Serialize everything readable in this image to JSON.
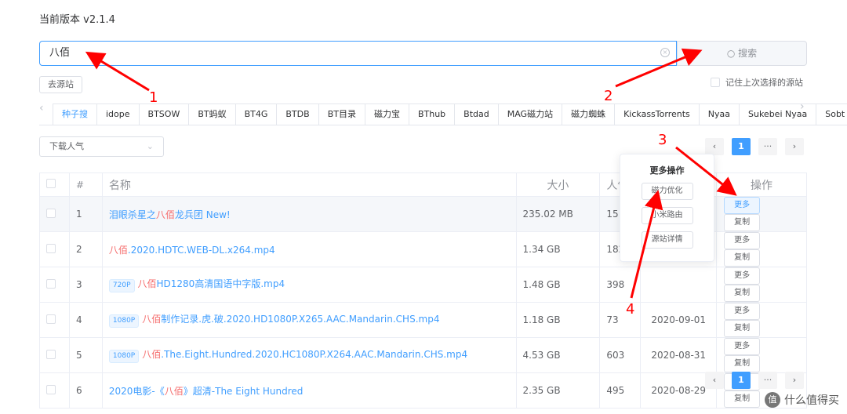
{
  "version": "当前版本 v2.1.4",
  "search": {
    "value": "八佰",
    "button": "搜索"
  },
  "go_source": "去源站",
  "remember": "记住上次选择的源站",
  "tabs": [
    "种子搜",
    "idope",
    "BTSOW",
    "BT蚂蚁",
    "BT4G",
    "BTDB",
    "BT目录",
    "磁力宝",
    "BThub",
    "Btdad",
    "MAG磁力站",
    "磁力蜘蛛",
    "KickassTorrents",
    "Nyaa",
    "Sukebei Nyaa",
    "Sobt"
  ],
  "sort": "下载人气",
  "pager": {
    "current": "1",
    "more": "···"
  },
  "table": {
    "headers": {
      "num": "#",
      "name": "名称",
      "size": "大小",
      "pop": "人气",
      "date": "",
      "ops": "操作"
    },
    "rows": [
      {
        "n": "1",
        "tag": "",
        "pre": "泪眼杀星之",
        "hl": "八佰",
        "post": "龙兵团 New!",
        "size": "235.02 MB",
        "pop": "15",
        "date": ""
      },
      {
        "n": "2",
        "tag": "",
        "pre": "",
        "hl": "八佰",
        "post": ".2020.HDTC.WEB-DL.x264.mp4",
        "size": "1.34 GB",
        "pop": "182",
        "date": ""
      },
      {
        "n": "3",
        "tag": "720P",
        "pre": "",
        "hl": "八佰",
        "post": "HD1280高清国语中字版.mp4",
        "size": "1.48 GB",
        "pop": "398",
        "date": ""
      },
      {
        "n": "4",
        "tag": "1080P",
        "pre": "",
        "hl": "八佰",
        "post": "制作记录.虎.破.2020.HD1080P.X265.AAC.Mandarin.CHS.mp4",
        "size": "1.18 GB",
        "pop": "73",
        "date": "2020-09-01"
      },
      {
        "n": "5",
        "tag": "1080P",
        "pre": "",
        "hl": "八佰",
        "post": ".The.Eight.Hundred.2020.HC1080P.X264.AAC.Mandarin.CHS.mp4",
        "size": "4.53 GB",
        "pop": "603",
        "date": "2020-08-31"
      },
      {
        "n": "6",
        "tag": "",
        "pre": "2020电影-《",
        "hl": "八佰",
        "post": "》超清-The Eight Hundred",
        "size": "2.35 GB",
        "pop": "495",
        "date": "2020-08-29"
      }
    ],
    "more": "更多",
    "copy": "复制"
  },
  "popover": {
    "title": "更多操作",
    "items": [
      "磁力优化",
      "小米路由",
      "源站详情"
    ]
  },
  "annotations": [
    "1",
    "2",
    "3",
    "4"
  ],
  "watermark": "什么值得买",
  "watermark_logo": "值"
}
